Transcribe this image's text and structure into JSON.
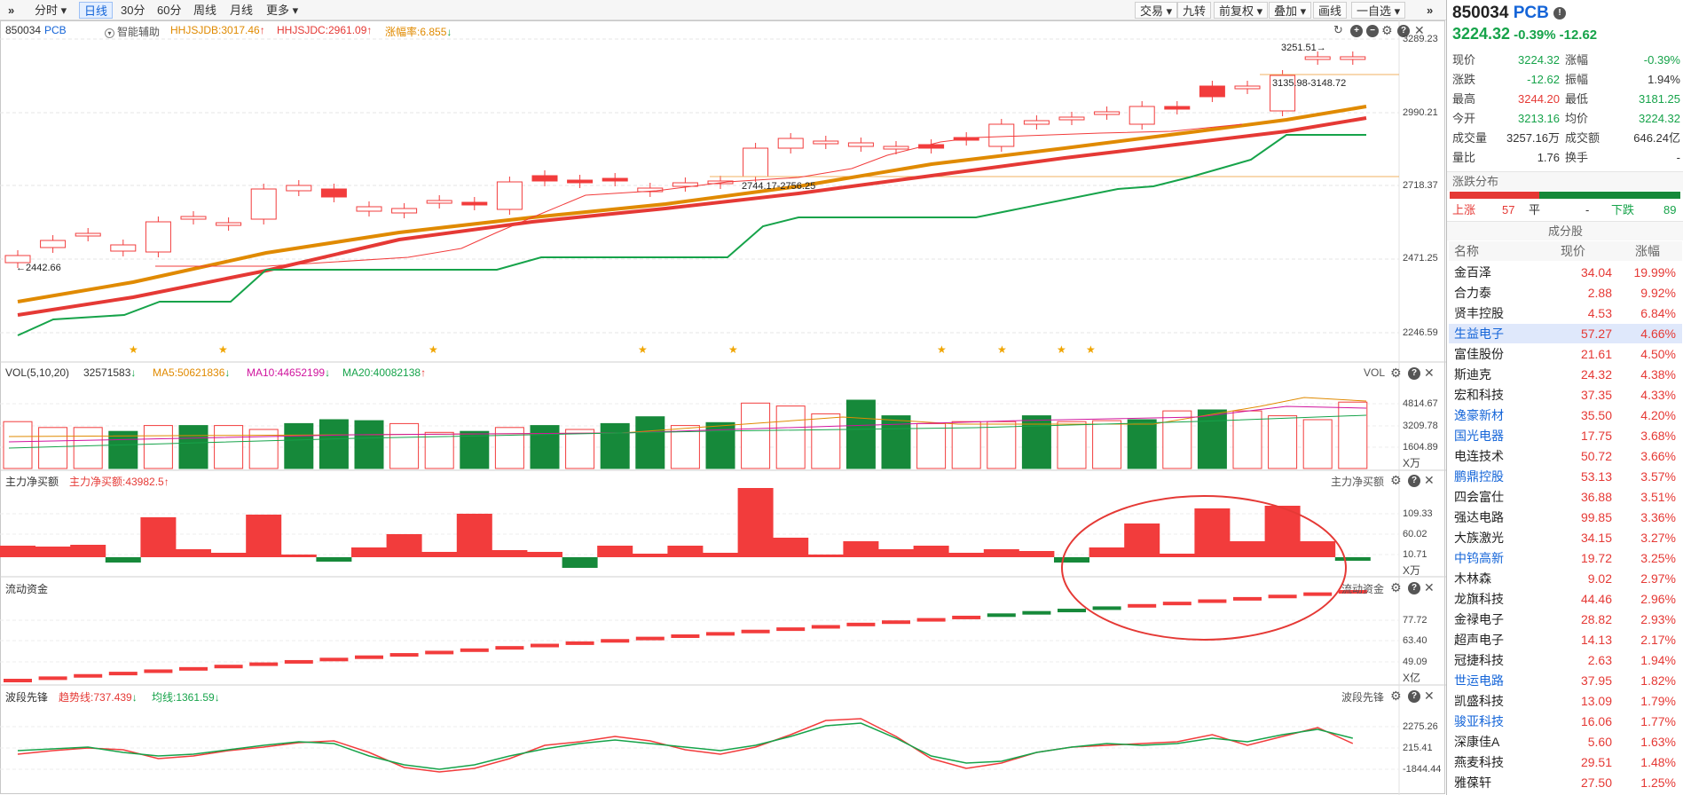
{
  "toolbar": {
    "expand_icon": "»",
    "tabs": [
      {
        "label": "分时 ▾",
        "active": false
      },
      {
        "label": "日线",
        "active": true
      },
      {
        "label": "30分",
        "active": false
      },
      {
        "label": "60分",
        "active": false
      },
      {
        "label": "周线",
        "active": false
      },
      {
        "label": "月线",
        "active": false
      },
      {
        "label": "更多 ▾",
        "active": false
      }
    ],
    "right_buttons": [
      "交易 ▾",
      "九转",
      "前复权 ▾",
      "叠加 ▾",
      "画线",
      "一自选 ▾"
    ],
    "collapse_icon": "»"
  },
  "main": {
    "code": "850034",
    "name": "PCB",
    "assist_label": "智能辅助",
    "indicators": [
      {
        "text": "HHJSJDB:3017.46",
        "color": "#e08a00",
        "arrow": "↑"
      },
      {
        "text": "HHJSJDC:2961.09",
        "color": "#e53935",
        "arrow": "↑"
      },
      {
        "text": "涨幅率:6.855",
        "color": "#e08a00",
        "arrow": "↓"
      }
    ],
    "axis_labels": [
      "3289.23",
      "2990.21",
      "2718.37",
      "2471.25",
      "2246.59"
    ],
    "annotations": {
      "high": "3251.51",
      "range1": "3135.98-3148.72",
      "range2": "2744.17-2756.25",
      "low": "2442.66"
    },
    "stars": [
      151,
      252,
      489,
      725,
      827,
      1062,
      1130,
      1197,
      1230
    ]
  },
  "volume": {
    "title": "VOL(5,10,20)",
    "value": "32571583",
    "ma5": "MA5:50621836",
    "ma10": "MA10:44652199",
    "ma20": "MA20:40082138",
    "right_label": "VOL",
    "axis": [
      "4814.67",
      "3209.78",
      "1604.89",
      "X万"
    ]
  },
  "netbuy": {
    "title": "主力净买额",
    "value": "主力净买额:43982.5",
    "right_label": "主力净买额",
    "axis": [
      "109.33",
      "60.02",
      "10.71",
      "X万"
    ]
  },
  "flow": {
    "title": "流动资金",
    "right_label": "流动资金",
    "axis": [
      "77.72",
      "63.40",
      "49.09",
      "X亿"
    ]
  },
  "wave": {
    "title": "波段先锋",
    "trend": "趋势线:737.439",
    "avg": "均线:1361.59",
    "right_label": "波段先锋",
    "axis": [
      "2275.26",
      "215.41",
      "-1844.44"
    ]
  },
  "panel": {
    "code": "850034",
    "name": "PCB",
    "price": "3224.32",
    "pct": "-0.39%",
    "chg": "-12.62",
    "quotes": [
      {
        "l1": "现价",
        "v1": "3224.32",
        "c1": "#16a34a",
        "l2": "涨幅",
        "v2": "-0.39%",
        "c2": "#16a34a"
      },
      {
        "l1": "涨跌",
        "v1": "-12.62",
        "c1": "#16a34a",
        "l2": "振幅",
        "v2": "1.94%",
        "c2": "#333"
      },
      {
        "l1": "最高",
        "v1": "3244.20",
        "c1": "#e53935",
        "l2": "最低",
        "v2": "3181.25",
        "c2": "#16a34a"
      },
      {
        "l1": "今开",
        "v1": "3213.16",
        "c1": "#16a34a",
        "l2": "均价",
        "v2": "3224.32",
        "c2": "#16a34a"
      },
      {
        "l1": "成交量",
        "v1": "3257.16万",
        "c1": "#333",
        "l2": "成交额",
        "v2": "646.24亿",
        "c2": "#333"
      },
      {
        "l1": "量比",
        "v1": "1.76",
        "c1": "#333",
        "l2": "换手",
        "v2": "-",
        "c2": "#333"
      }
    ],
    "dist_title": "涨跌分布",
    "up_label": "上涨",
    "up_count": "57",
    "flat_label": "平",
    "flat_count": "-",
    "down_label": "下跌",
    "down_count": "89",
    "up_fraction": 0.39,
    "constituents_title": "成分股",
    "col_name": "名称",
    "col_price": "现价",
    "col_pct": "涨幅",
    "stocks": [
      {
        "name": "金百泽",
        "price": "34.04",
        "pct": "19.99%",
        "blue": false
      },
      {
        "name": "合力泰",
        "price": "2.88",
        "pct": "9.92%",
        "blue": false
      },
      {
        "name": "贤丰控股",
        "price": "4.53",
        "pct": "6.84%",
        "blue": false
      },
      {
        "name": "生益电子",
        "price": "57.27",
        "pct": "4.66%",
        "blue": true
      },
      {
        "name": "富佳股份",
        "price": "21.61",
        "pct": "4.50%",
        "blue": false
      },
      {
        "name": "斯迪克",
        "price": "24.32",
        "pct": "4.38%",
        "blue": false
      },
      {
        "name": "宏和科技",
        "price": "37.35",
        "pct": "4.33%",
        "blue": false
      },
      {
        "name": "逸豪新材",
        "price": "35.50",
        "pct": "4.20%",
        "blue": true
      },
      {
        "name": "国光电器",
        "price": "17.75",
        "pct": "3.68%",
        "blue": true
      },
      {
        "name": "电连技术",
        "price": "50.72",
        "pct": "3.66%",
        "blue": false
      },
      {
        "name": "鹏鼎控股",
        "price": "53.13",
        "pct": "3.57%",
        "blue": true
      },
      {
        "name": "四会富仕",
        "price": "36.88",
        "pct": "3.51%",
        "blue": false
      },
      {
        "name": "强达电路",
        "price": "99.85",
        "pct": "3.36%",
        "blue": false
      },
      {
        "name": "大族激光",
        "price": "34.15",
        "pct": "3.27%",
        "blue": false
      },
      {
        "name": "中钨高新",
        "price": "19.72",
        "pct": "3.25%",
        "blue": true
      },
      {
        "name": "木林森",
        "price": "9.02",
        "pct": "2.97%",
        "blue": false
      },
      {
        "name": "龙旗科技",
        "price": "44.46",
        "pct": "2.96%",
        "blue": false
      },
      {
        "name": "金禄电子",
        "price": "28.82",
        "pct": "2.93%",
        "blue": false
      },
      {
        "name": "超声电子",
        "price": "14.13",
        "pct": "2.17%",
        "blue": false
      },
      {
        "name": "冠捷科技",
        "price": "2.63",
        "pct": "1.94%",
        "blue": false
      },
      {
        "name": "世运电路",
        "price": "37.95",
        "pct": "1.82%",
        "blue": true
      },
      {
        "name": "凯盛科技",
        "price": "13.09",
        "pct": "1.79%",
        "blue": false
      },
      {
        "name": "骏亚科技",
        "price": "16.06",
        "pct": "1.77%",
        "blue": true
      },
      {
        "name": "深康佳A",
        "price": "5.60",
        "pct": "1.63%",
        "blue": false
      },
      {
        "name": "燕麦科技",
        "price": "29.51",
        "pct": "1.48%",
        "blue": false
      },
      {
        "name": "雅葆轩",
        "price": "27.50",
        "pct": "1.25%",
        "blue": false
      }
    ]
  },
  "colors": {
    "up": "#f23c3c",
    "down": "#16893a",
    "ma_orange": "#e08a00",
    "ma_red": "#e53935",
    "ma_green": "#16a34a",
    "blue": "#1565d8"
  }
}
